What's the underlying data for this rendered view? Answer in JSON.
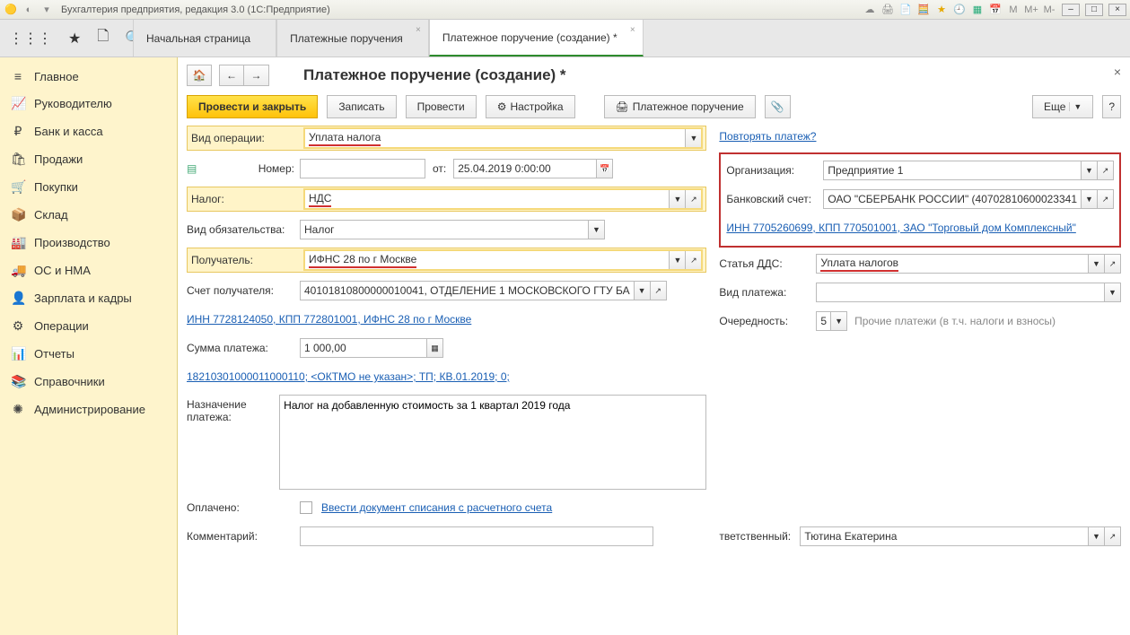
{
  "window": {
    "title": "Бухгалтерия предприятия, редакция 3.0  (1С:Предприятие)"
  },
  "tabs": [
    {
      "label": "Начальная страница",
      "closable": false,
      "active": false
    },
    {
      "label": "Платежные поручения",
      "closable": true,
      "active": false
    },
    {
      "label": "Платежное поручение (создание) *",
      "closable": true,
      "active": true
    }
  ],
  "sidebar": [
    {
      "icon": "≡",
      "label": "Главное"
    },
    {
      "icon": "📈",
      "label": "Руководителю"
    },
    {
      "icon": "₽",
      "label": "Банк и касса"
    },
    {
      "icon": "🛍",
      "label": "Продажи"
    },
    {
      "icon": "🛒",
      "label": "Покупки"
    },
    {
      "icon": "📦",
      "label": "Склад"
    },
    {
      "icon": "🏭",
      "label": "Производство"
    },
    {
      "icon": "🚚",
      "label": "ОС и НМА"
    },
    {
      "icon": "👤",
      "label": "Зарплата и кадры"
    },
    {
      "icon": "⚙",
      "label": "Операции"
    },
    {
      "icon": "📊",
      "label": "Отчеты"
    },
    {
      "icon": "📚",
      "label": "Справочники"
    },
    {
      "icon": "✺",
      "label": "Администрирование"
    }
  ],
  "doc": {
    "title": "Платежное поручение (создание) *"
  },
  "actions": {
    "post_close": "Провести и закрыть",
    "save": "Записать",
    "post": "Провести",
    "settings": "Настройка",
    "print_order": "Платежное поручение",
    "more": "Еще",
    "help": "?"
  },
  "form": {
    "op_type_label": "Вид операции:",
    "op_type_value": "Уплата налога",
    "repeat_link": "Повторять платеж?",
    "number_label": "Номер:",
    "number_value": "",
    "from_label": "от:",
    "date_value": "25.04.2019 0:00:00",
    "tax_label": "Налог:",
    "tax_value": "НДС",
    "obligation_label": "Вид обязательства:",
    "obligation_value": "Налог",
    "recipient_label": "Получатель:",
    "recipient_value": "ИФНС 28 по г Москве",
    "recipient_acc_label": "Счет получателя:",
    "recipient_acc_value": "40101810800000010041, ОТДЕЛЕНИЕ 1 МОСКОВСКОГО ГТУ БА",
    "recipient_link": "ИНН 7728124050, КПП 772801001, ИФНС 28 по г Москве",
    "sum_label": "Сумма платежа:",
    "sum_value": "1 000,00",
    "kbk_link": "18210301000011000110; <ОКТМО не указан>; ТП; КВ.01.2019; 0;",
    "purpose_label": "Назначение платежа:",
    "purpose_value": "Налог на добавленную стоимость за 1 квартал 2019 года",
    "paid_label": "Оплачено:",
    "paid_link": "Ввести документ списания с расчетного счета",
    "comment_label": "Комментарий:",
    "comment_value": ""
  },
  "right": {
    "org_label": "Организация:",
    "org_value": "Предприятие 1",
    "bank_label": "Банковский счет:",
    "bank_value": "ОАО \"СБЕРБАНК РОССИИ\" (40702810600023341",
    "org_link": "ИНН 7705260699, КПП 770501001, ЗАО \"Торговый дом Комплексный\"",
    "dds_label": "Статья ДДС:",
    "dds_value": "Уплата налогов",
    "ptype_label": "Вид платежа:",
    "ptype_value": "",
    "priority_label": "Очередность:",
    "priority_value": "5",
    "priority_desc": "Прочие платежи (в т.ч. налоги и взносы)",
    "responsible_label": "тветственный:",
    "responsible_value": "Тютина Екатерина"
  }
}
